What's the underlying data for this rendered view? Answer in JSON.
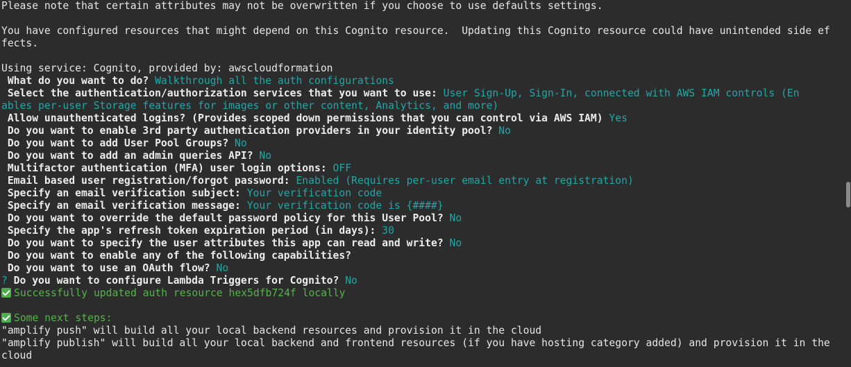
{
  "lines": {
    "l1": "Please note that certain attributes may not be overwritten if you choose to use defaults settings.",
    "l3": "You have configured resources that might depend on this Cognito resource.  Updating this Cognito resource could have unintended side ef",
    "l4": "fects.",
    "l6": "Using service: Cognito, provided by: awscloudformation"
  },
  "qa": [
    {
      "q": " What do you want to do?",
      "a": "Walkthrough all the auth configurations"
    },
    {
      "q": " Select the authentication/authorization services that you want to use:",
      "a": "User Sign-Up, Sign-In, connected with AWS IAM controls (En"
    },
    {
      "q": "",
      "a": "ables per-user Storage features for images or other content, Analytics, and more)"
    },
    {
      "q": " Allow unauthenticated logins? (Provides scoped down permissions that you can control via AWS IAM)",
      "a": "Yes"
    },
    {
      "q": " Do you want to enable 3rd party authentication providers in your identity pool?",
      "a": "No"
    },
    {
      "q": " Do you want to add User Pool Groups?",
      "a": "No"
    },
    {
      "q": " Do you want to add an admin queries API?",
      "a": "No"
    },
    {
      "q": " Multifactor authentication (MFA) user login options:",
      "a": "OFF"
    },
    {
      "q": " Email based user registration/forgot password:",
      "a": "Enabled (Requires per-user email entry at registration)"
    },
    {
      "q": " Specify an email verification subject:",
      "a": "Your verification code"
    },
    {
      "q": " Specify an email verification message:",
      "a": "Your verification code is {####}"
    },
    {
      "q": " Do you want to override the default password policy for this User Pool?",
      "a": "No"
    },
    {
      "q": " Specify the app's refresh token expiration period (in days):",
      "a": "30"
    },
    {
      "q": " Do you want to specify the user attributes this app can read and write?",
      "a": "No"
    },
    {
      "q": " Do you want to enable any of the following capabilities?",
      "a": ""
    },
    {
      "q": " Do you want to use an OAuth flow?",
      "a": "No"
    }
  ],
  "lambda": {
    "mark": "?",
    "q": " Do you want to configure Lambda Triggers for Cognito?",
    "a": "No"
  },
  "success": "Successfully updated auth resource hex5dfb724f locally",
  "next_steps": "Some next steps:",
  "push": "\"amplify push\" will build all your local backend resources and provision it in the cloud",
  "publish1": "\"amplify publish\" will build all your local backend and frontend resources (if you have hosting category added) and provision it in the",
  "publish2": "cloud"
}
